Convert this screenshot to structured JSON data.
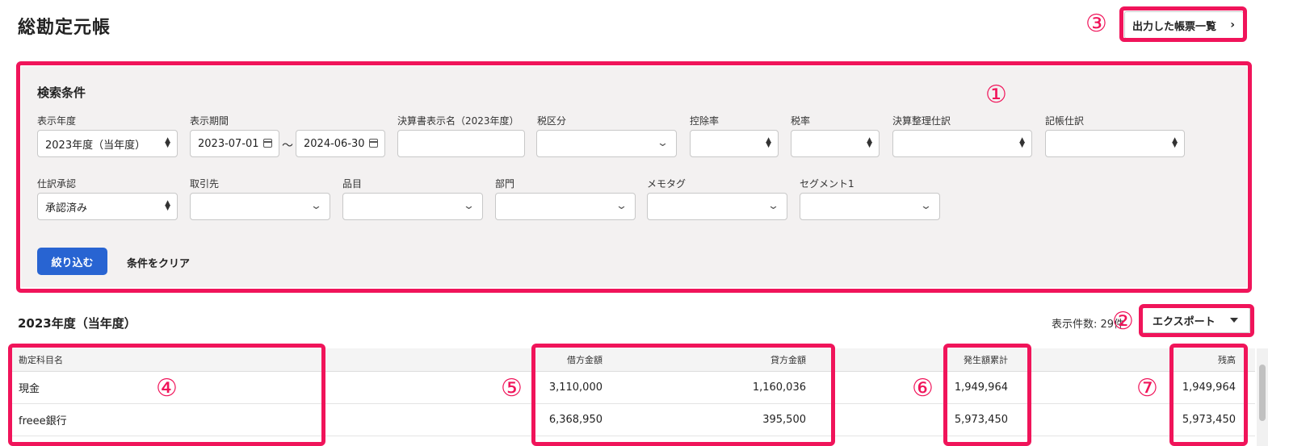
{
  "page": {
    "title": "総勘定元帳"
  },
  "header": {
    "report_list_label": "出力した帳票一覧"
  },
  "search": {
    "title": "検索条件",
    "fields": {
      "fiscal_year": {
        "label": "表示年度",
        "value": "2023年度（当年度）"
      },
      "period": {
        "label": "表示期間",
        "start": "2023-07-01",
        "end": "2024-06-30",
        "separator": "〜"
      },
      "statement_name": {
        "label": "決算書表示名（2023年度）",
        "value": ""
      },
      "tax_category": {
        "label": "税区分",
        "value": ""
      },
      "deduction_rate": {
        "label": "控除率",
        "value": ""
      },
      "tax_rate": {
        "label": "税率",
        "value": ""
      },
      "closing_entries": {
        "label": "決算整理仕訳",
        "value": ""
      },
      "recorded_entries": {
        "label": "記帳仕訳",
        "value": ""
      },
      "approval": {
        "label": "仕訳承認",
        "value": "承認済み"
      },
      "partner": {
        "label": "取引先",
        "value": ""
      },
      "item": {
        "label": "品目",
        "value": ""
      },
      "department": {
        "label": "部門",
        "value": ""
      },
      "memo_tag": {
        "label": "メモタグ",
        "value": ""
      },
      "segment1": {
        "label": "セグメント1",
        "value": ""
      }
    },
    "filter_button": "絞り込む",
    "clear_button": "条件をクリア"
  },
  "results": {
    "title": "2023年度（当年度）",
    "count_text": "表示件数: 29件",
    "export_label": "エクスポート",
    "columns": {
      "account": "勘定科目名",
      "debit": "借方金額",
      "credit": "貸方金額",
      "cumulative": "発生額累計",
      "balance": "残高"
    },
    "rows": [
      {
        "account": "現金",
        "debit": "3,110,000",
        "credit": "1,160,036",
        "cumulative": "1,949,964",
        "balance": "1,949,964"
      },
      {
        "account": "freee銀行",
        "debit": "6,368,950",
        "credit": "395,500",
        "cumulative": "5,973,450",
        "balance": "5,973,450"
      }
    ]
  },
  "annotations": {
    "color": "#f0145a",
    "markers": [
      "①",
      "②",
      "③",
      "④",
      "⑤",
      "⑥",
      "⑦"
    ]
  },
  "colors": {
    "primary": "#2864d2",
    "highlight": "#f0145a",
    "panel_bg": "#f3f1f1"
  }
}
